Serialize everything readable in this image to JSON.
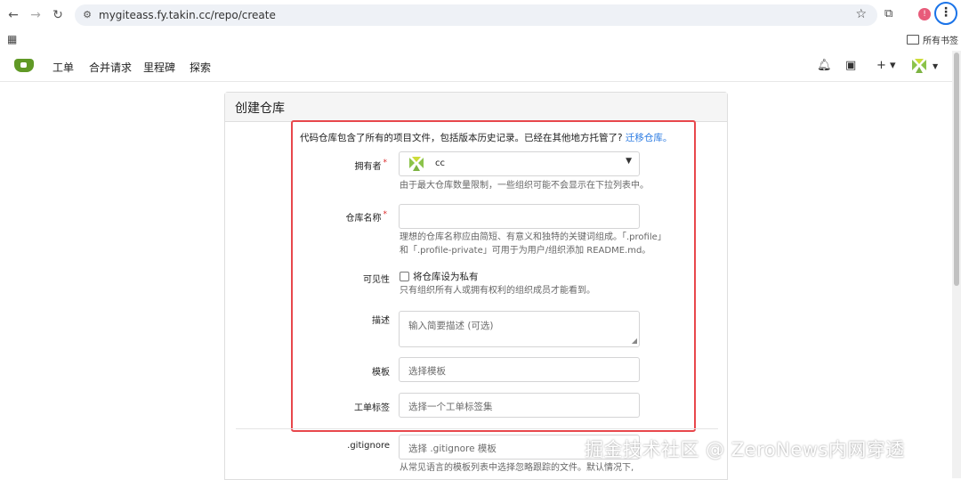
{
  "browser": {
    "url": "mygiteass.fy.takin.cc/repo/create",
    "bookmarks_label": "所有书签",
    "profile_initial": "!"
  },
  "nav": {
    "issues": "工单",
    "pulls": "合并请求",
    "milestones": "里程碑",
    "explore": "探索",
    "plus": "+ ▾"
  },
  "form": {
    "title": "创建仓库",
    "intro_text": "代码仓库包含了所有的项目文件，包括版本历史记录。已经在其他地方托管了?",
    "intro_link": "迁移仓库。",
    "owner_label": "拥有者",
    "owner_value": "cc",
    "owner_help": "由于最大仓库数量限制，一些组织可能不会显示在下拉列表中。",
    "repo_name_label": "仓库名称",
    "repo_name_value": "",
    "repo_name_help_1": "理想的仓库名称应由简短、有意义和独特的关键词组成。「.profile」",
    "repo_name_help_2": "和「.profile-private」可用于为用户/组织添加 README.md。",
    "visibility_label": "可见性",
    "private_checkbox_label": "将仓库设为私有",
    "private_checked": false,
    "visibility_help": "只有组织所有人或拥有权利的组织成员才能看到。",
    "description_label": "描述",
    "description_placeholder": "输入简要描述 (可选)",
    "template_label": "模板",
    "template_placeholder": "选择模板",
    "issue_labels_label": "工单标签",
    "issue_labels_placeholder": "选择一个工单标签集",
    "gitignore_label": ".gitignore",
    "gitignore_placeholder": "选择 .gitignore 模板",
    "gitignore_help": "从常见语言的模板列表中选择忽略跟踪的文件。默认情况下,"
  },
  "colors": {
    "brand": "#609926",
    "highlight_box": "#e8474c",
    "link": "#2a7ae2",
    "required": "#db2828"
  },
  "watermark": "掘金技术社区 @ ZeroNews内网穿透"
}
